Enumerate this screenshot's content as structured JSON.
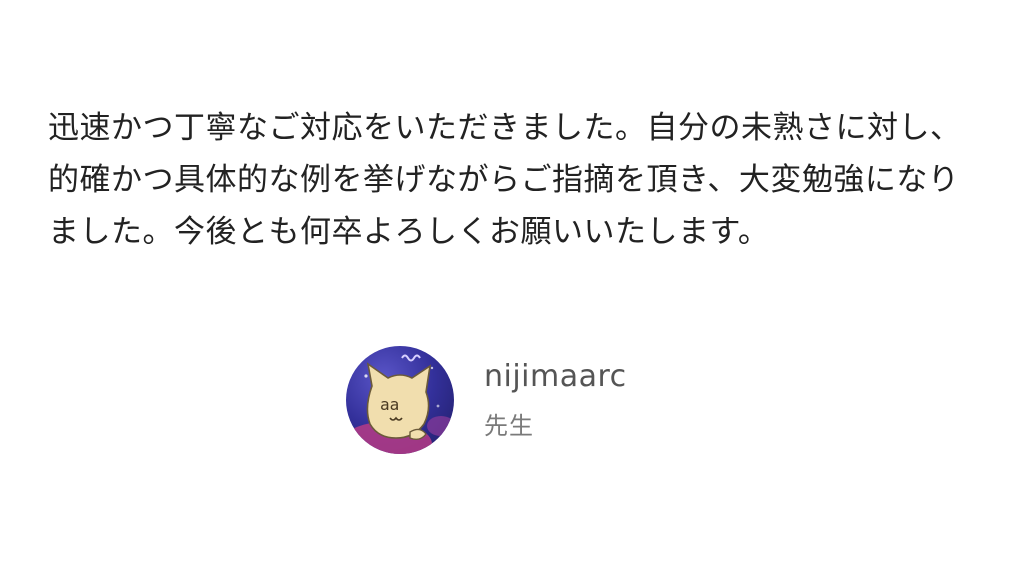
{
  "review": {
    "lines": [
      "迅速かつ丁寧なご対応をいただきました。自分の未熟さに対し、",
      "的確かつ具体的な例を挙げながらご指摘を頂き、大変勉強になり",
      "ました。今後とも何卒よろしくお願いいたします。"
    ]
  },
  "author": {
    "name": "nijimaarc",
    "role": "先生",
    "avatar_icon": "cat-character-avatar",
    "avatar_text": "aa"
  },
  "colors": {
    "background": "#ffffff",
    "body_text": "#222222",
    "name_text": "#555555",
    "role_text": "#7a7a7a",
    "avatar_bg_top": "#3a3aa8",
    "avatar_bg_bottom": "#b0397c"
  }
}
